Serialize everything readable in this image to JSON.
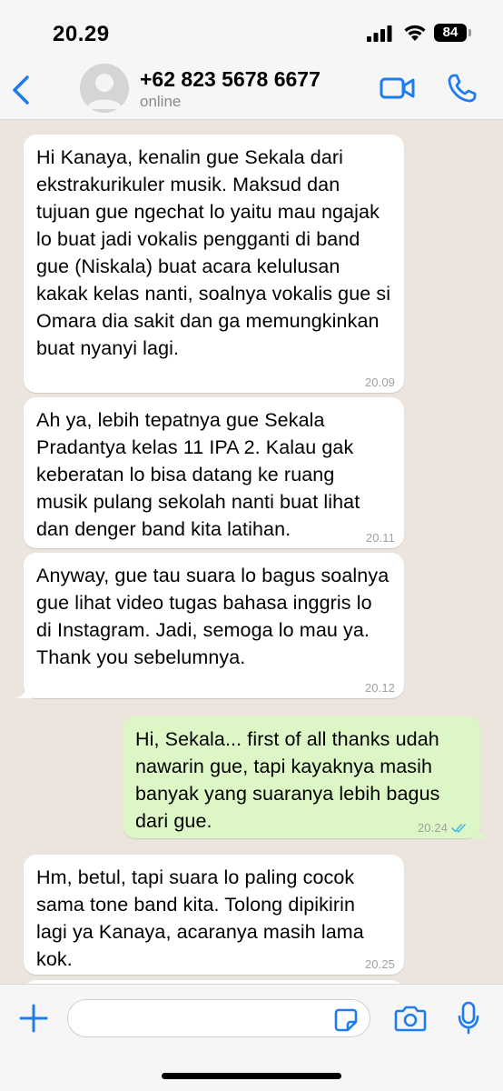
{
  "status_bar": {
    "time": "20.29",
    "battery": "84"
  },
  "header": {
    "contact_name": "+62 823 5678 6677",
    "contact_status": "online"
  },
  "messages": [
    {
      "direction": "in",
      "text": "Hi Kanaya, kenalin gue Sekala dari ekstrakurikuler musik. Maksud dan tujuan gue ngechat lo yaitu mau ngajak lo buat jadi vokalis pengganti di band gue (Niskala) buat acara kelulusan kakak kelas nanti, soalnya vokalis gue si Omara dia sakit dan ga memungkinkan buat nyanyi lagi.",
      "time": "20.09"
    },
    {
      "direction": "in",
      "text": "Ah ya, lebih tepatnya gue Sekala Pradantya kelas 11 IPA 2. Kalau gak keberatan lo bisa datang ke ruang musik pulang sekolah nanti buat lihat dan denger band kita latihan.",
      "time": "20.11"
    },
    {
      "direction": "in",
      "text": "Anyway, gue tau suara lo bagus soalnya gue lihat video tugas bahasa inggris lo di Instagram. Jadi, semoga lo mau ya. Thank you sebelumnya.",
      "time": "20.12"
    },
    {
      "direction": "out",
      "text": "Hi, Sekala... first of all thanks udah nawarin gue, tapi kayaknya masih banyak yang suaranya lebih bagus dari gue.",
      "time": "20.24",
      "status": "read"
    },
    {
      "direction": "in",
      "text": "Hm, betul, tapi suara lo paling cocok sama tone band kita. Tolong dipikirin lagi ya Kanaya, acaranya masih lama kok.",
      "time": "20.25"
    }
  ],
  "input": {
    "placeholder": "",
    "value": ""
  },
  "colors": {
    "accent": "#1f7cf0",
    "chat_background": "#ebe5de",
    "incoming_bubble": "#ffffff",
    "outgoing_bubble": "#dcf7c5",
    "read_ticks": "#4fb6ec"
  },
  "icons": [
    "back-icon",
    "avatar-placeholder",
    "video-call-icon",
    "phone-icon",
    "plus-icon",
    "sticker-icon",
    "camera-icon",
    "microphone-icon"
  ]
}
